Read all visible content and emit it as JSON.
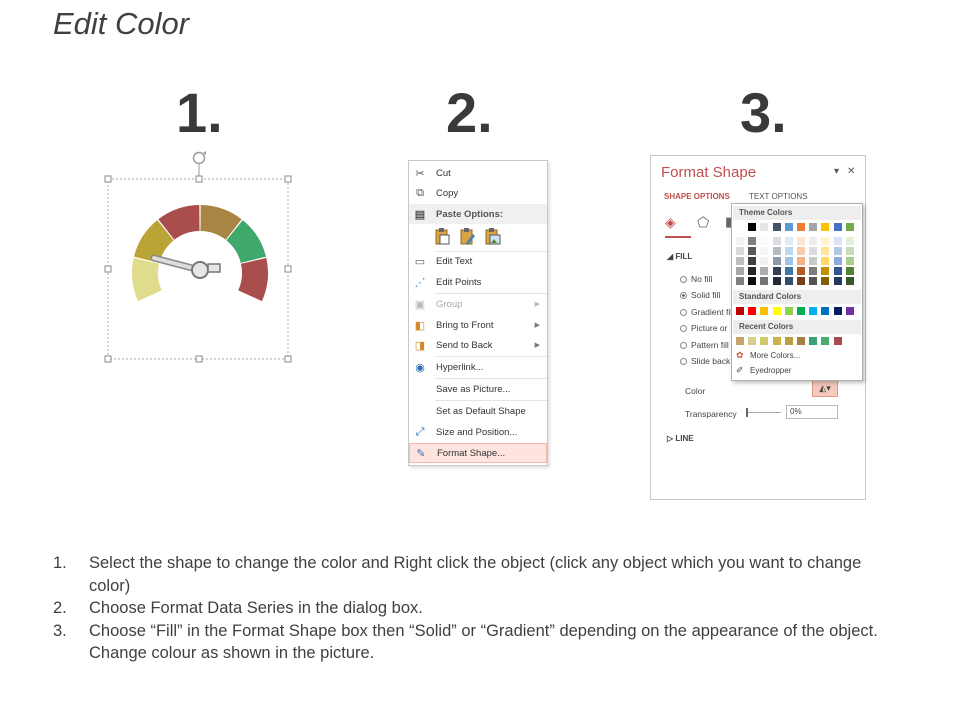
{
  "title": "Edit Color",
  "steps": [
    "1.",
    "2.",
    "3."
  ],
  "context_menu": {
    "items": [
      {
        "label": "Cut",
        "icon": "scissors-icon",
        "glyph": "✂",
        "disabled": false
      },
      {
        "label": "Copy",
        "icon": "copy-icon",
        "glyph": "⧉",
        "disabled": false
      },
      {
        "label": "Paste Options:",
        "icon": "paste-icon",
        "glyph": "📋",
        "disabled": false
      },
      {
        "label": "Edit Text",
        "icon": "edit-text-icon",
        "glyph": "A",
        "disabled": false
      },
      {
        "label": "Edit Points",
        "icon": "edit-points-icon",
        "glyph": "⋰",
        "disabled": false
      },
      {
        "label": "Group",
        "icon": "group-icon",
        "glyph": "▣",
        "disabled": true
      },
      {
        "label": "Bring to Front",
        "icon": "bring-front-icon",
        "glyph": "◧",
        "disabled": false
      },
      {
        "label": "Send to Back",
        "icon": "send-back-icon",
        "glyph": "◨",
        "disabled": false
      },
      {
        "label": "Hyperlink...",
        "icon": "hyperlink-icon",
        "glyph": "🌐",
        "disabled": false
      },
      {
        "label": "Save as Picture...",
        "icon": "",
        "glyph": "",
        "disabled": false
      },
      {
        "label": "Set as Default Shape",
        "icon": "",
        "glyph": "",
        "disabled": false
      },
      {
        "label": "Size and Position...",
        "icon": "size-position-icon",
        "glyph": "⤢",
        "disabled": false
      },
      {
        "label": "Format Shape...",
        "icon": "format-shape-icon",
        "glyph": "🖌",
        "disabled": false
      }
    ]
  },
  "format_shape": {
    "title": "Format Shape",
    "controls": [
      "▾",
      "✕"
    ],
    "tabs": [
      "SHAPE OPTIONS",
      "TEXT OPTIONS"
    ],
    "fill_label": "FILL",
    "fill_options": [
      "No fill",
      "Solid fill",
      "Gradient fill",
      "Picture or",
      "Pattern fill",
      "Slide back"
    ],
    "color_label": "Color",
    "transparency_label": "Transparency",
    "transparency_value": "0%",
    "line_label": "LINE",
    "accent": "#c0504d"
  },
  "palette": {
    "theme_label": "Theme Colors",
    "standard_label": "Standard Colors",
    "recent_label": "Recent Colors",
    "more_colors": "More Colors...",
    "eyedropper": "Eyedropper",
    "theme_top": [
      "#ffffff",
      "#000000",
      "#e7e6e6",
      "#44546a",
      "#5b9bd5",
      "#ed7d31",
      "#a5a5a5",
      "#ffc000",
      "#4472c4",
      "#70ad47"
    ],
    "standard": [
      "#c00000",
      "#ff0000",
      "#ffc000",
      "#ffff00",
      "#92d050",
      "#00b050",
      "#00b0f0",
      "#0070c0",
      "#002060",
      "#7030a0"
    ],
    "recent": [
      "#c8a46a",
      "#d6cf8a",
      "#d4c96a",
      "#c9b54c",
      "#b8a044",
      "#a58040",
      "#3aa373",
      "#4bab6e",
      "#a64a4a"
    ]
  },
  "gauge": {
    "segments": [
      "#e0dc8e",
      "#bba436",
      "#a94d4d",
      "#a98543",
      "#3fa86b",
      "#a94d4d"
    ]
  },
  "instructions": [
    {
      "num": "1.",
      "text": "Select the shape to change the color and Right click the object (click any object which you want to change color)"
    },
    {
      "num": "2.",
      "text": "Choose Format Data Series in the dialog box."
    },
    {
      "num": "3.",
      "text": "Choose “Fill” in the Format Shape box then “Solid” or “Gradient” depending on the appearance of the object. Change colour as shown in the picture."
    }
  ]
}
